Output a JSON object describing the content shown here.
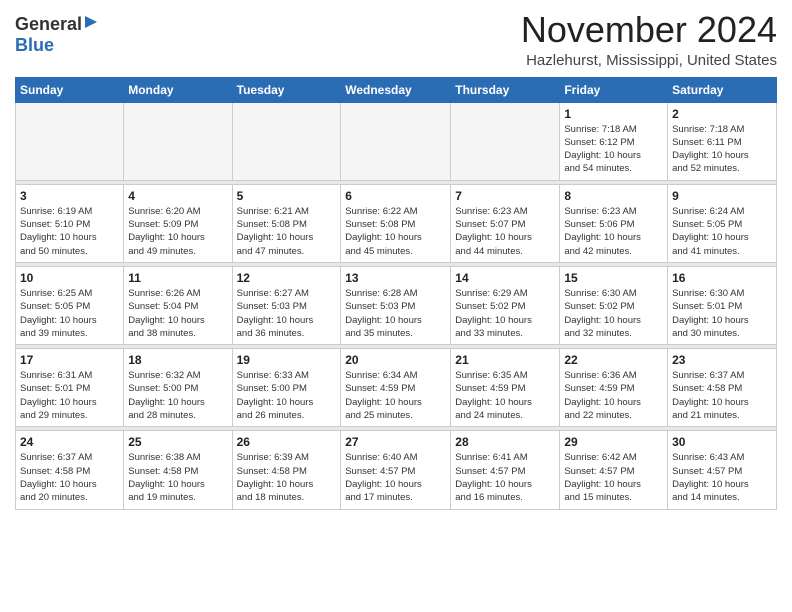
{
  "logo": {
    "general": "General",
    "blue": "Blue"
  },
  "header": {
    "month": "November 2024",
    "location": "Hazlehurst, Mississippi, United States"
  },
  "weekdays": [
    "Sunday",
    "Monday",
    "Tuesday",
    "Wednesday",
    "Thursday",
    "Friday",
    "Saturday"
  ],
  "weeks": [
    [
      {
        "day": "",
        "info": ""
      },
      {
        "day": "",
        "info": ""
      },
      {
        "day": "",
        "info": ""
      },
      {
        "day": "",
        "info": ""
      },
      {
        "day": "",
        "info": ""
      },
      {
        "day": "1",
        "info": "Sunrise: 7:18 AM\nSunset: 6:12 PM\nDaylight: 10 hours\nand 54 minutes."
      },
      {
        "day": "2",
        "info": "Sunrise: 7:18 AM\nSunset: 6:11 PM\nDaylight: 10 hours\nand 52 minutes."
      }
    ],
    [
      {
        "day": "3",
        "info": "Sunrise: 6:19 AM\nSunset: 5:10 PM\nDaylight: 10 hours\nand 50 minutes."
      },
      {
        "day": "4",
        "info": "Sunrise: 6:20 AM\nSunset: 5:09 PM\nDaylight: 10 hours\nand 49 minutes."
      },
      {
        "day": "5",
        "info": "Sunrise: 6:21 AM\nSunset: 5:08 PM\nDaylight: 10 hours\nand 47 minutes."
      },
      {
        "day": "6",
        "info": "Sunrise: 6:22 AM\nSunset: 5:08 PM\nDaylight: 10 hours\nand 45 minutes."
      },
      {
        "day": "7",
        "info": "Sunrise: 6:23 AM\nSunset: 5:07 PM\nDaylight: 10 hours\nand 44 minutes."
      },
      {
        "day": "8",
        "info": "Sunrise: 6:23 AM\nSunset: 5:06 PM\nDaylight: 10 hours\nand 42 minutes."
      },
      {
        "day": "9",
        "info": "Sunrise: 6:24 AM\nSunset: 5:05 PM\nDaylight: 10 hours\nand 41 minutes."
      }
    ],
    [
      {
        "day": "10",
        "info": "Sunrise: 6:25 AM\nSunset: 5:05 PM\nDaylight: 10 hours\nand 39 minutes."
      },
      {
        "day": "11",
        "info": "Sunrise: 6:26 AM\nSunset: 5:04 PM\nDaylight: 10 hours\nand 38 minutes."
      },
      {
        "day": "12",
        "info": "Sunrise: 6:27 AM\nSunset: 5:03 PM\nDaylight: 10 hours\nand 36 minutes."
      },
      {
        "day": "13",
        "info": "Sunrise: 6:28 AM\nSunset: 5:03 PM\nDaylight: 10 hours\nand 35 minutes."
      },
      {
        "day": "14",
        "info": "Sunrise: 6:29 AM\nSunset: 5:02 PM\nDaylight: 10 hours\nand 33 minutes."
      },
      {
        "day": "15",
        "info": "Sunrise: 6:30 AM\nSunset: 5:02 PM\nDaylight: 10 hours\nand 32 minutes."
      },
      {
        "day": "16",
        "info": "Sunrise: 6:30 AM\nSunset: 5:01 PM\nDaylight: 10 hours\nand 30 minutes."
      }
    ],
    [
      {
        "day": "17",
        "info": "Sunrise: 6:31 AM\nSunset: 5:01 PM\nDaylight: 10 hours\nand 29 minutes."
      },
      {
        "day": "18",
        "info": "Sunrise: 6:32 AM\nSunset: 5:00 PM\nDaylight: 10 hours\nand 28 minutes."
      },
      {
        "day": "19",
        "info": "Sunrise: 6:33 AM\nSunset: 5:00 PM\nDaylight: 10 hours\nand 26 minutes."
      },
      {
        "day": "20",
        "info": "Sunrise: 6:34 AM\nSunset: 4:59 PM\nDaylight: 10 hours\nand 25 minutes."
      },
      {
        "day": "21",
        "info": "Sunrise: 6:35 AM\nSunset: 4:59 PM\nDaylight: 10 hours\nand 24 minutes."
      },
      {
        "day": "22",
        "info": "Sunrise: 6:36 AM\nSunset: 4:59 PM\nDaylight: 10 hours\nand 22 minutes."
      },
      {
        "day": "23",
        "info": "Sunrise: 6:37 AM\nSunset: 4:58 PM\nDaylight: 10 hours\nand 21 minutes."
      }
    ],
    [
      {
        "day": "24",
        "info": "Sunrise: 6:37 AM\nSunset: 4:58 PM\nDaylight: 10 hours\nand 20 minutes."
      },
      {
        "day": "25",
        "info": "Sunrise: 6:38 AM\nSunset: 4:58 PM\nDaylight: 10 hours\nand 19 minutes."
      },
      {
        "day": "26",
        "info": "Sunrise: 6:39 AM\nSunset: 4:58 PM\nDaylight: 10 hours\nand 18 minutes."
      },
      {
        "day": "27",
        "info": "Sunrise: 6:40 AM\nSunset: 4:57 PM\nDaylight: 10 hours\nand 17 minutes."
      },
      {
        "day": "28",
        "info": "Sunrise: 6:41 AM\nSunset: 4:57 PM\nDaylight: 10 hours\nand 16 minutes."
      },
      {
        "day": "29",
        "info": "Sunrise: 6:42 AM\nSunset: 4:57 PM\nDaylight: 10 hours\nand 15 minutes."
      },
      {
        "day": "30",
        "info": "Sunrise: 6:43 AM\nSunset: 4:57 PM\nDaylight: 10 hours\nand 14 minutes."
      }
    ]
  ]
}
